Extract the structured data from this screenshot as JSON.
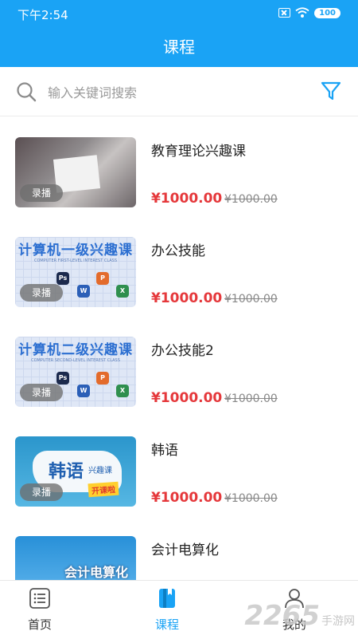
{
  "status_bar": {
    "time": "下午2:54",
    "battery": "100"
  },
  "header": {
    "title": "课程"
  },
  "search": {
    "placeholder": "输入关键词搜索"
  },
  "courses": [
    {
      "title": "教育理论兴趣课",
      "price": "¥1000.00",
      "original_price": "¥1000.00",
      "badge": "录播"
    },
    {
      "title": "办公技能",
      "price": "¥1000.00",
      "original_price": "¥1000.00",
      "badge": "录播",
      "thumb_title": "计算机一级兴趣课",
      "thumb_subtitle": "COMPUTER FIRST-LEVEL INTEREST CLASS"
    },
    {
      "title": "办公技能2",
      "price": "¥1000.00",
      "original_price": "¥1000.00",
      "badge": "录播",
      "thumb_title": "计算机二级兴趣课",
      "thumb_subtitle": "COMPUTER SECOND-LEVEL INTEREST CLASS"
    },
    {
      "title": "韩语",
      "price": "¥1000.00",
      "original_price": "¥1000.00",
      "badge": "录播",
      "thumb_title": "韩语",
      "thumb_tag": "兴趣课",
      "thumb_badge": "开课啦"
    },
    {
      "title": "会计电算化",
      "thumb_title": "会计电算化"
    }
  ],
  "thumb_apps": [
    "Ps",
    "W",
    "P",
    "X"
  ],
  "tabs": [
    {
      "label": "首页",
      "icon": "list-icon",
      "active": false
    },
    {
      "label": "课程",
      "icon": "book-icon",
      "active": true
    },
    {
      "label": "我的",
      "icon": "user-icon",
      "active": false
    }
  ],
  "watermark": {
    "number": "2265",
    "text": "手游网"
  },
  "colors": {
    "primary": "#1aa3f5",
    "price": "#e5383b"
  }
}
